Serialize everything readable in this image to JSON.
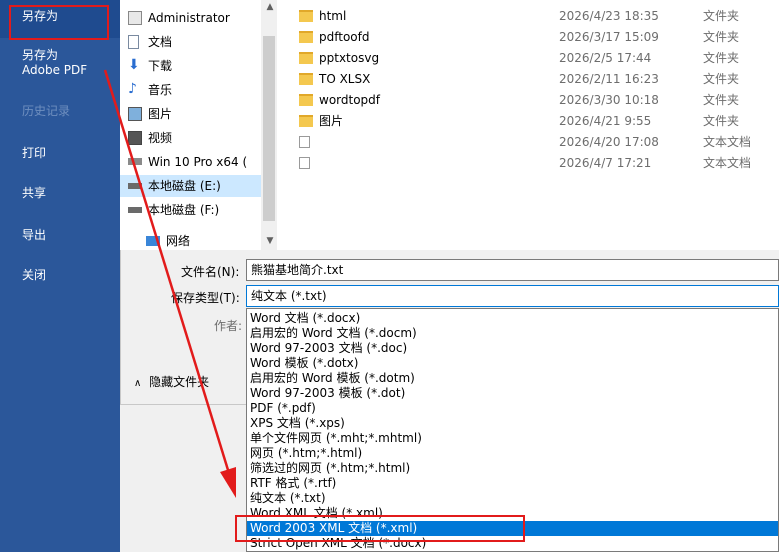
{
  "backstage": {
    "items": [
      {
        "label": "另存为",
        "active": true
      },
      {
        "label": "另存为\nAdobe PDF"
      },
      {
        "label": "历史记录",
        "disabled": true
      },
      {
        "label": "打印"
      },
      {
        "label": "共享"
      },
      {
        "label": "导出"
      },
      {
        "label": "关闭"
      }
    ]
  },
  "nav": {
    "items": [
      {
        "label": "Administrator",
        "icon": "user-icon"
      },
      {
        "label": "文档",
        "icon": "documents-icon"
      },
      {
        "label": "下载",
        "icon": "download-icon"
      },
      {
        "label": "音乐",
        "icon": "music-icon"
      },
      {
        "label": "图片",
        "icon": "pictures-icon"
      },
      {
        "label": "视频",
        "icon": "video-icon"
      },
      {
        "label": "Win 10 Pro x64 (",
        "icon": "drive-icon"
      },
      {
        "label": "本地磁盘 (E:)",
        "icon": "drive-icon",
        "selected": true
      },
      {
        "label": "本地磁盘 (F:)",
        "icon": "drive-icon"
      },
      {
        "label": "网络",
        "icon": "network-icon"
      }
    ]
  },
  "files": [
    {
      "name": "html",
      "date": "2026/4/23 18:35",
      "type": "文件夹",
      "kind": "folder"
    },
    {
      "name": "pdftoofd",
      "date": "2026/3/17 15:09",
      "type": "文件夹",
      "kind": "folder"
    },
    {
      "name": "pptxtosvg",
      "date": "2026/2/5 17:44",
      "type": "文件夹",
      "kind": "folder"
    },
    {
      "name": "TO XLSX",
      "date": "2026/2/11 16:23",
      "type": "文件夹",
      "kind": "folder"
    },
    {
      "name": "wordtopdf",
      "date": "2026/3/30 10:18",
      "type": "文件夹",
      "kind": "folder"
    },
    {
      "name": "图片",
      "date": "2026/4/21 9:55",
      "type": "文件夹",
      "kind": "folder"
    },
    {
      "name": "",
      "date": "2026/4/20 17:08",
      "type": "文本文档",
      "kind": "doc"
    },
    {
      "name": "",
      "date": "2026/4/7 17:21",
      "type": "文本文档",
      "kind": "doc"
    }
  ],
  "form": {
    "filename_label": "文件名(N):",
    "filename_value": "熊猫基地简介.txt",
    "savetype_label": "保存类型(T):",
    "savetype_value": "纯文本 (*.txt)",
    "author_label": "作者:",
    "hide_folders": "隐藏文件夹"
  },
  "dropdown": {
    "options": [
      "Word 文档 (*.docx)",
      "启用宏的 Word 文档 (*.docm)",
      "Word 97-2003 文档 (*.doc)",
      "Word 模板 (*.dotx)",
      "启用宏的 Word 模板 (*.dotm)",
      "Word 97-2003 模板 (*.dot)",
      "PDF (*.pdf)",
      "XPS 文档 (*.xps)",
      "单个文件网页 (*.mht;*.mhtml)",
      "网页 (*.htm;*.html)",
      "筛选过的网页 (*.htm;*.html)",
      "RTF 格式 (*.rtf)",
      "纯文本 (*.txt)",
      "Word XML 文档 (*.xml)",
      "Word 2003 XML 文档 (*.xml)",
      "Strict Open XML 文档 (*.docx)"
    ],
    "highlighted_index": 14
  },
  "colors": {
    "accent": "#2b579a",
    "highlight": "#0078d7",
    "annotation": "#e21b1b"
  }
}
